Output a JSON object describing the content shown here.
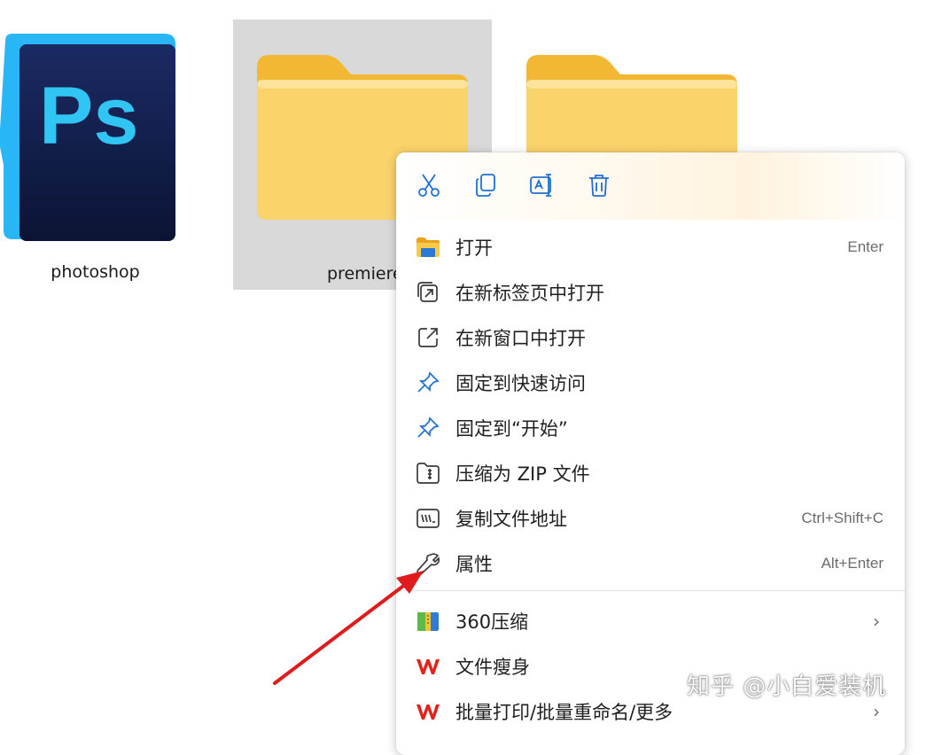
{
  "desktop": {
    "items": [
      {
        "label": "photoshop",
        "icon": "photoshop-app-icon"
      },
      {
        "label": "premiere",
        "icon": "folder-icon"
      },
      {
        "label": "",
        "icon": "folder-icon"
      }
    ],
    "ps_logo_text": "Ps"
  },
  "context_menu": {
    "toolbar": [
      {
        "icon": "cut-icon"
      },
      {
        "icon": "copy-icon"
      },
      {
        "icon": "rename-icon"
      },
      {
        "icon": "delete-icon"
      }
    ],
    "items": [
      {
        "label": "打开",
        "shortcut": "Enter",
        "icon": "folder-open-icon"
      },
      {
        "label": "在新标签页中打开",
        "shortcut": "",
        "icon": "new-tab-icon"
      },
      {
        "label": "在新窗口中打开",
        "shortcut": "",
        "icon": "new-window-icon"
      },
      {
        "label": "固定到快速访问",
        "shortcut": "",
        "icon": "pin-icon"
      },
      {
        "label": "固定到“开始”",
        "shortcut": "",
        "icon": "pin-icon"
      },
      {
        "label": "压缩为 ZIP 文件",
        "shortcut": "",
        "icon": "zip-icon"
      },
      {
        "label": "复制文件地址",
        "shortcut": "Ctrl+Shift+C",
        "icon": "copy-path-icon"
      },
      {
        "label": "属性",
        "shortcut": "Alt+Enter",
        "icon": "wrench-icon"
      }
    ],
    "extra_items": [
      {
        "label": "360压缩",
        "icon": "360-zip-icon",
        "has_submenu": true
      },
      {
        "label": "文件瘦身",
        "icon": "wps-icon",
        "has_submenu": false
      },
      {
        "label": "批量打印/批量重命名/更多",
        "icon": "wps-icon",
        "has_submenu": true
      }
    ],
    "submenu_chevron": "›"
  },
  "watermark": "知乎 @小白爱装机",
  "colors": {
    "selection": "#d9d9d9",
    "folder": "#f8c94a",
    "accent_blue": "#1f6fd1",
    "wps_red": "#e2231a",
    "arrow_red": "#e01b1b"
  }
}
